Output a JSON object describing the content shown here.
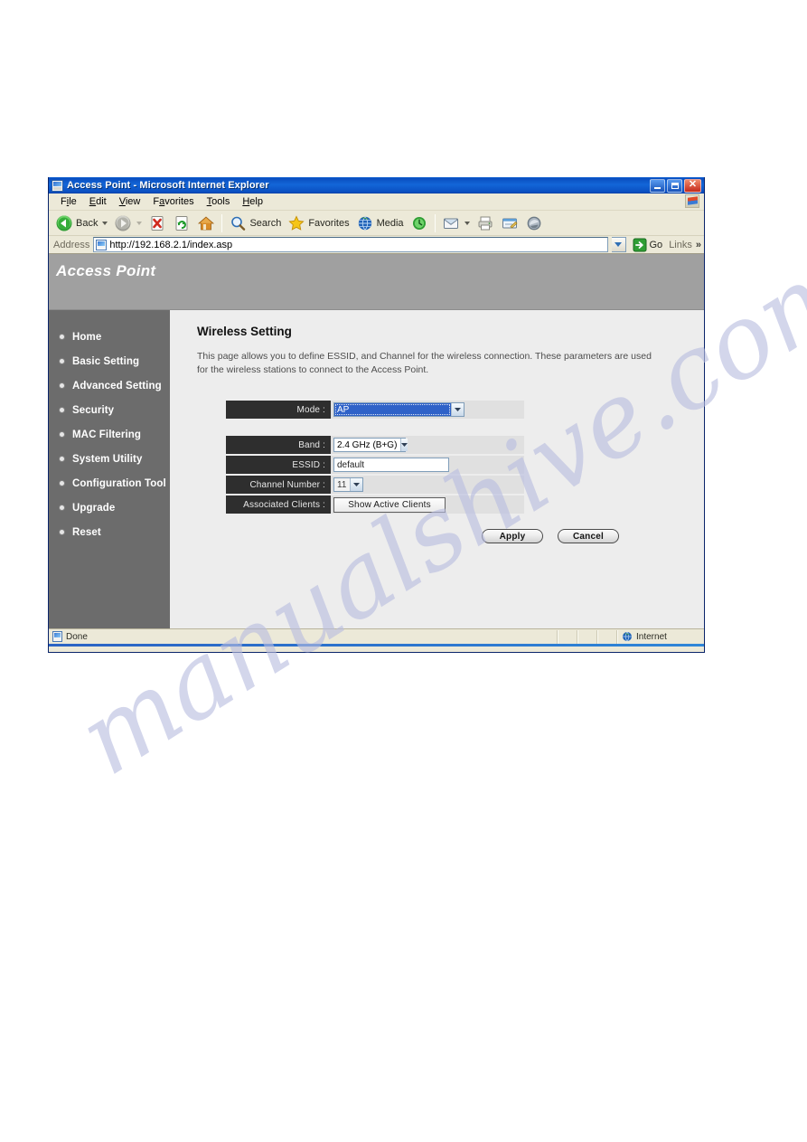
{
  "window": {
    "title": "Access Point - Microsoft Internet Explorer",
    "minimize_label": "Minimize",
    "maximize_label": "Restore",
    "close_label": "Close"
  },
  "menubar": {
    "items": [
      {
        "pre": "F",
        "accel": "i",
        "post": "le"
      },
      {
        "pre": "",
        "accel": "E",
        "post": "dit"
      },
      {
        "pre": "",
        "accel": "V",
        "post": "iew"
      },
      {
        "pre": "F",
        "accel": "a",
        "post": "vorites"
      },
      {
        "pre": "",
        "accel": "T",
        "post": "ools"
      },
      {
        "pre": "",
        "accel": "H",
        "post": "elp"
      }
    ]
  },
  "toolbar": {
    "back_label": "Back",
    "forward_label": "",
    "stop_label": "",
    "refresh_label": "",
    "home_label": "",
    "search_label": "Search",
    "favorites_label": "Favorites",
    "media_label": "Media",
    "history_label": ""
  },
  "address": {
    "label": "Address",
    "url": "http://192.168.2.1/index.asp",
    "go_label": "Go",
    "links_label": "Links",
    "overflow_chevron": "»"
  },
  "banner": {
    "product_title": "Access Point"
  },
  "sidebar": {
    "items": [
      {
        "label": "Home"
      },
      {
        "label": "Basic Setting"
      },
      {
        "label": "Advanced Setting"
      },
      {
        "label": "Security"
      },
      {
        "label": "MAC Filtering"
      },
      {
        "label": "System Utility"
      },
      {
        "label": "Configuration Tool"
      },
      {
        "label": "Upgrade"
      },
      {
        "label": "Reset"
      }
    ]
  },
  "main": {
    "heading": "Wireless Setting",
    "description": "This page allows you to define ESSID, and Channel for the wireless connection. These parameters are used for the wireless stations to connect to the Access Point.",
    "fields": {
      "mode": {
        "label": "Mode :",
        "value": "AP",
        "focused": true
      },
      "band": {
        "label": "Band :",
        "value": "2.4 GHz (B+G)"
      },
      "essid": {
        "label": "ESSID :",
        "value": "default"
      },
      "channel": {
        "label": "Channel Number :",
        "value": "11"
      },
      "associated_clients": {
        "label": "Associated Clients :",
        "button_label": "Show Active Clients"
      }
    },
    "actions": {
      "apply_label": "Apply",
      "cancel_label": "Cancel"
    }
  },
  "statusbar": {
    "status_text": "Done",
    "zone_text": "Internet"
  },
  "watermark": {
    "line1": "manualshive.com"
  },
  "colors": {
    "titlebar_blue": "#0a4fc0",
    "banner_grey": "#a0a0a0",
    "sidebar_grey": "#6c6c6c",
    "content_grey": "#ededed",
    "label_dark": "#2e2e2e",
    "select_highlight": "#2f62c8",
    "chrome_beige": "#ece9d8",
    "watermark_violet": "#b9bde0"
  }
}
